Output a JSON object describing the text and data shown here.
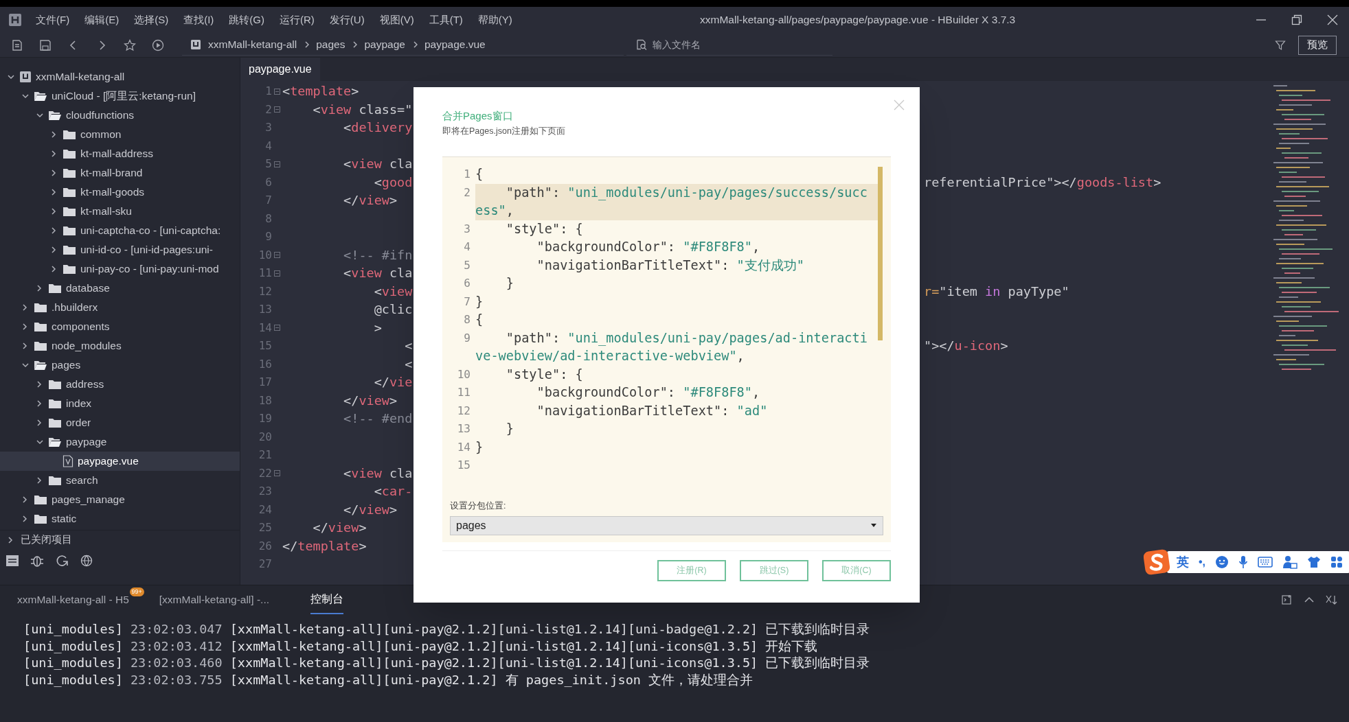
{
  "menu_bar": {
    "items": [
      "文件(F)",
      "编辑(E)",
      "选择(S)",
      "查找(I)",
      "跳转(G)",
      "运行(R)",
      "发行(U)",
      "视图(V)",
      "工具(T)",
      "帮助(Y)"
    ]
  },
  "window": {
    "title": "xxmMall-ketang-all/pages/paypage/paypage.vue - HBuilder X 3.7.3"
  },
  "toolbar": {
    "breadcrumb": [
      "xxmMall-ketang-all",
      "pages",
      "paypage",
      "paypage.vue"
    ],
    "search": {
      "placeholder": "输入文件名"
    },
    "preview_button": "预览"
  },
  "sidebar": {
    "tree": [
      {
        "label": "xxmMall-ketang-all",
        "kind": "project",
        "expanded": true,
        "selected": false,
        "children": [
          {
            "label": "uniCloud - [阿里云:ketang-run]",
            "kind": "folder",
            "expanded": true,
            "selected": false,
            "children": [
              {
                "label": "cloudfunctions",
                "kind": "folder",
                "expanded": true,
                "selected": false,
                "children": [
                  {
                    "label": "common",
                    "kind": "folder",
                    "expanded": false,
                    "selected": false
                  },
                  {
                    "label": "kt-mall-address",
                    "kind": "folder",
                    "expanded": false,
                    "selected": false
                  },
                  {
                    "label": "kt-mall-brand",
                    "kind": "folder",
                    "expanded": false,
                    "selected": false
                  },
                  {
                    "label": "kt-mall-goods",
                    "kind": "folder",
                    "expanded": false,
                    "selected": false
                  },
                  {
                    "label": "kt-mall-sku",
                    "kind": "folder",
                    "expanded": false,
                    "selected": false
                  },
                  {
                    "label": "uni-captcha-co - [uni-captcha:",
                    "kind": "folder",
                    "expanded": false,
                    "selected": false
                  },
                  {
                    "label": "uni-id-co - [uni-id-pages:uni-",
                    "kind": "folder",
                    "expanded": false,
                    "selected": false
                  },
                  {
                    "label": "uni-pay-co - [uni-pay:uni-mod",
                    "kind": "folder",
                    "expanded": false,
                    "selected": false
                  }
                ]
              },
              {
                "label": "database",
                "kind": "folder",
                "expanded": false,
                "selected": false
              }
            ]
          },
          {
            "label": ".hbuilderx",
            "kind": "folder",
            "expanded": false,
            "selected": false
          },
          {
            "label": "components",
            "kind": "folder",
            "expanded": false,
            "selected": false
          },
          {
            "label": "node_modules",
            "kind": "folder",
            "expanded": false,
            "selected": false
          },
          {
            "label": "pages",
            "kind": "folder",
            "expanded": true,
            "selected": false,
            "children": [
              {
                "label": "address",
                "kind": "folder",
                "expanded": false,
                "selected": false
              },
              {
                "label": "index",
                "kind": "folder",
                "expanded": false,
                "selected": false
              },
              {
                "label": "order",
                "kind": "folder",
                "expanded": false,
                "selected": false
              },
              {
                "label": "paypage",
                "kind": "folder",
                "expanded": true,
                "selected": false,
                "children": [
                  {
                    "label": "paypage.vue",
                    "kind": "file",
                    "selected": true
                  }
                ]
              },
              {
                "label": "search",
                "kind": "folder",
                "expanded": false,
                "selected": false
              }
            ]
          },
          {
            "label": "pages_manage",
            "kind": "folder",
            "expanded": false,
            "selected": false
          },
          {
            "label": "static",
            "kind": "folder",
            "expanded": false,
            "selected": false
          }
        ]
      }
    ],
    "closed_projects": "已关闭项目"
  },
  "editor": {
    "tab": "paypage.vue",
    "lines": [
      {
        "number": "1",
        "fold": true,
        "code": [
          {
            "text": "<",
            "kind": "plain"
          },
          {
            "text": "template",
            "kind": "tag"
          },
          {
            "text": ">",
            "kind": "plain"
          }
        ]
      },
      {
        "number": "2",
        "fold": true,
        "code": [
          {
            "text": "    <",
            "kind": "plain"
          },
          {
            "text": "view",
            "kind": "tag"
          },
          {
            "text": " class=\"",
            "kind": "plain"
          }
        ]
      },
      {
        "number": "3",
        "fold": false,
        "code": [
          {
            "text": "        <",
            "kind": "plain"
          },
          {
            "text": "delivery",
            "kind": "tag"
          }
        ]
      },
      {
        "number": "4",
        "fold": false
      },
      {
        "number": "5",
        "fold": true,
        "code": [
          {
            "text": "        <",
            "kind": "plain"
          },
          {
            "text": "view",
            "kind": "tag"
          },
          {
            "text": " cla",
            "kind": "plain"
          }
        ]
      },
      {
        "number": "6",
        "fold": false,
        "code": [
          {
            "text": "            <",
            "kind": "plain"
          },
          {
            "text": "good",
            "kind": "tag"
          }
        ],
        "right": [
          {
            "text": "referentialPrice\"></",
            "kind": "plain"
          },
          {
            "text": "goods-list",
            "kind": "tag"
          },
          {
            "text": ">",
            "kind": "plain"
          }
        ]
      },
      {
        "number": "7",
        "fold": false,
        "code": [
          {
            "text": "        </",
            "kind": "plain"
          },
          {
            "text": "view",
            "kind": "tag"
          },
          {
            "text": ">",
            "kind": "plain"
          }
        ]
      },
      {
        "number": "8",
        "fold": false
      },
      {
        "number": "9",
        "fold": false
      },
      {
        "number": "10",
        "fold": true,
        "code": [
          {
            "text": "        <!-- #ifn",
            "kind": "comment"
          }
        ]
      },
      {
        "number": "11",
        "fold": true,
        "code": [
          {
            "text": "        <",
            "kind": "plain"
          },
          {
            "text": "view",
            "kind": "tag"
          },
          {
            "text": " cla",
            "kind": "plain"
          }
        ]
      },
      {
        "number": "12",
        "fold": false,
        "code": [
          {
            "text": "            <",
            "kind": "plain"
          },
          {
            "text": "view",
            "kind": "tag"
          }
        ],
        "right": [
          {
            "text": "r=",
            "kind": "attr"
          },
          {
            "text": "\"item ",
            "kind": "plain"
          },
          {
            "text": "in",
            "kind": "keyword"
          },
          {
            "text": " payType\"",
            "kind": "plain"
          }
        ]
      },
      {
        "number": "13",
        "fold": false,
        "code": [
          {
            "text": "            @clic",
            "kind": "plain"
          }
        ]
      },
      {
        "number": "14",
        "fold": true,
        "code": [
          {
            "text": "            >",
            "kind": "plain"
          }
        ]
      },
      {
        "number": "15",
        "fold": false,
        "code": [
          {
            "text": "                <",
            "kind": "plain"
          }
        ],
        "right": [
          {
            "text": "\"></",
            "kind": "plain"
          },
          {
            "text": "u-icon",
            "kind": "tag"
          },
          {
            "text": ">",
            "kind": "plain"
          }
        ]
      },
      {
        "number": "16",
        "fold": false,
        "code": [
          {
            "text": "                <",
            "kind": "plain"
          }
        ]
      },
      {
        "number": "17",
        "fold": false,
        "code": [
          {
            "text": "            </",
            "kind": "plain"
          },
          {
            "text": "vie",
            "kind": "tag"
          }
        ]
      },
      {
        "number": "18",
        "fold": false,
        "code": [
          {
            "text": "        </",
            "kind": "plain"
          },
          {
            "text": "view",
            "kind": "tag"
          },
          {
            "text": ">",
            "kind": "plain"
          }
        ]
      },
      {
        "number": "19",
        "fold": false,
        "code": [
          {
            "text": "        <!-- #end",
            "kind": "comment"
          }
        ]
      },
      {
        "number": "20",
        "fold": false
      },
      {
        "number": "21",
        "fold": false
      },
      {
        "number": "22",
        "fold": true,
        "code": [
          {
            "text": "        <",
            "kind": "plain"
          },
          {
            "text": "view",
            "kind": "tag"
          },
          {
            "text": " cla",
            "kind": "plain"
          }
        ]
      },
      {
        "number": "23",
        "fold": false,
        "code": [
          {
            "text": "            <",
            "kind": "plain"
          },
          {
            "text": "car-",
            "kind": "tag"
          }
        ]
      },
      {
        "number": "24",
        "fold": false,
        "code": [
          {
            "text": "        </",
            "kind": "plain"
          },
          {
            "text": "view",
            "kind": "tag"
          },
          {
            "text": ">",
            "kind": "plain"
          }
        ]
      },
      {
        "number": "25",
        "fold": false,
        "code": [
          {
            "text": "    </",
            "kind": "plain"
          },
          {
            "text": "view",
            "kind": "tag"
          },
          {
            "text": ">",
            "kind": "plain"
          }
        ]
      },
      {
        "number": "26",
        "fold": false,
        "code": [
          {
            "text": "</",
            "kind": "plain"
          },
          {
            "text": "template",
            "kind": "tag"
          },
          {
            "text": ">",
            "kind": "plain"
          }
        ]
      },
      {
        "number": "27",
        "fold": false
      }
    ]
  },
  "dialog": {
    "title": "合并Pages窗口",
    "subtitle": "即将在Pages.json注册如下页面",
    "code_lines": [
      {
        "number": "1",
        "highlighted": false,
        "code": [
          {
            "text": "{",
            "kind": "punct"
          }
        ]
      },
      {
        "number": "2",
        "highlighted": true,
        "code": [
          {
            "text": "    \"path\": ",
            "kind": "key"
          },
          {
            "text": "\"uni_modules/uni-pay/pages/success/succ",
            "kind": "string"
          }
        ]
      },
      {
        "highlighted": true,
        "code": [
          {
            "text": "ess\"",
            "kind": "string"
          },
          {
            "text": ",",
            "kind": "punct"
          }
        ]
      },
      {
        "number": "3",
        "highlighted": false,
        "code": [
          {
            "text": "    \"style\": {",
            "kind": "key"
          }
        ]
      },
      {
        "number": "4",
        "highlighted": false,
        "code": [
          {
            "text": "        \"backgroundColor\": ",
            "kind": "key"
          },
          {
            "text": "\"#F8F8F8\"",
            "kind": "string"
          },
          {
            "text": ",",
            "kind": "punct"
          }
        ]
      },
      {
        "number": "5",
        "highlighted": false,
        "code": [
          {
            "text": "        \"navigationBarTitleText\": ",
            "kind": "key"
          },
          {
            "text": "\"支付成功\"",
            "kind": "string"
          }
        ]
      },
      {
        "number": "6",
        "highlighted": false,
        "code": [
          {
            "text": "    }",
            "kind": "punct"
          }
        ]
      },
      {
        "number": "7",
        "highlighted": false,
        "code": [
          {
            "text": "}",
            "kind": "punct"
          }
        ]
      },
      {
        "number": "8",
        "highlighted": false,
        "code": [
          {
            "text": "{",
            "kind": "punct"
          }
        ]
      },
      {
        "number": "9",
        "highlighted": false,
        "code": [
          {
            "text": "    \"path\": ",
            "kind": "key"
          },
          {
            "text": "\"uni_modules/uni-pay/pages/ad-interacti",
            "kind": "string"
          }
        ]
      },
      {
        "highlighted": false,
        "code": [
          {
            "text": "ve-webview/ad-interactive-webview\"",
            "kind": "string"
          },
          {
            "text": ",",
            "kind": "punct"
          }
        ]
      },
      {
        "number": "10",
        "highlighted": false,
        "code": [
          {
            "text": "    \"style\": {",
            "kind": "key"
          }
        ]
      },
      {
        "number": "11",
        "highlighted": false,
        "code": [
          {
            "text": "        \"backgroundColor\": ",
            "kind": "key"
          },
          {
            "text": "\"#F8F8F8\"",
            "kind": "string"
          },
          {
            "text": ",",
            "kind": "punct"
          }
        ]
      },
      {
        "number": "12",
        "highlighted": false,
        "code": [
          {
            "text": "        \"navigationBarTitleText\": ",
            "kind": "key"
          },
          {
            "text": "\"ad\"",
            "kind": "string"
          }
        ]
      },
      {
        "number": "13",
        "highlighted": false,
        "code": [
          {
            "text": "    }",
            "kind": "punct"
          }
        ]
      },
      {
        "number": "14",
        "highlighted": false,
        "code": [
          {
            "text": "}",
            "kind": "punct"
          }
        ]
      },
      {
        "number": "15",
        "highlighted": false
      }
    ],
    "subpackage_label": "设置分包位置:",
    "subpackage_select": "pages",
    "buttons": [
      "注册(R)",
      "跳过(S)",
      "取消(C)"
    ]
  },
  "bottom_panel": {
    "tabs": [
      {
        "label": "xxmMall-ketang-all - H5",
        "badge": "99+",
        "selected": false
      },
      {
        "label": "[xxmMall-ketang-all] -...",
        "selected": false
      },
      {
        "label": "控制台",
        "selected": true
      }
    ],
    "console_lines": [
      {
        "source": "[uni_modules]",
        "time": "23:02:03.047",
        "message": "[xxmMall-ketang-all][uni-pay@2.1.2][uni-list@1.2.14][uni-badge@1.2.2] 已下载到临时目录"
      },
      {
        "source": "[uni_modules]",
        "time": "23:02:03.412",
        "message": "[xxmMall-ketang-all][uni-pay@2.1.2][uni-list@1.2.14][uni-icons@1.3.5] 开始下载"
      },
      {
        "source": "[uni_modules]",
        "time": "23:02:03.460",
        "message": "[xxmMall-ketang-all][uni-pay@2.1.2][uni-list@1.2.14][uni-icons@1.3.5] 已下载到临时目录"
      },
      {
        "source": "[uni_modules]",
        "time": "23:02:03.755",
        "message": "[xxmMall-ketang-all][uni-pay@2.1.2] 有 pages_init.json 文件，请处理合并"
      }
    ]
  },
  "ime_toolbar": {
    "mode": "英",
    "punctuation": "•,"
  }
}
